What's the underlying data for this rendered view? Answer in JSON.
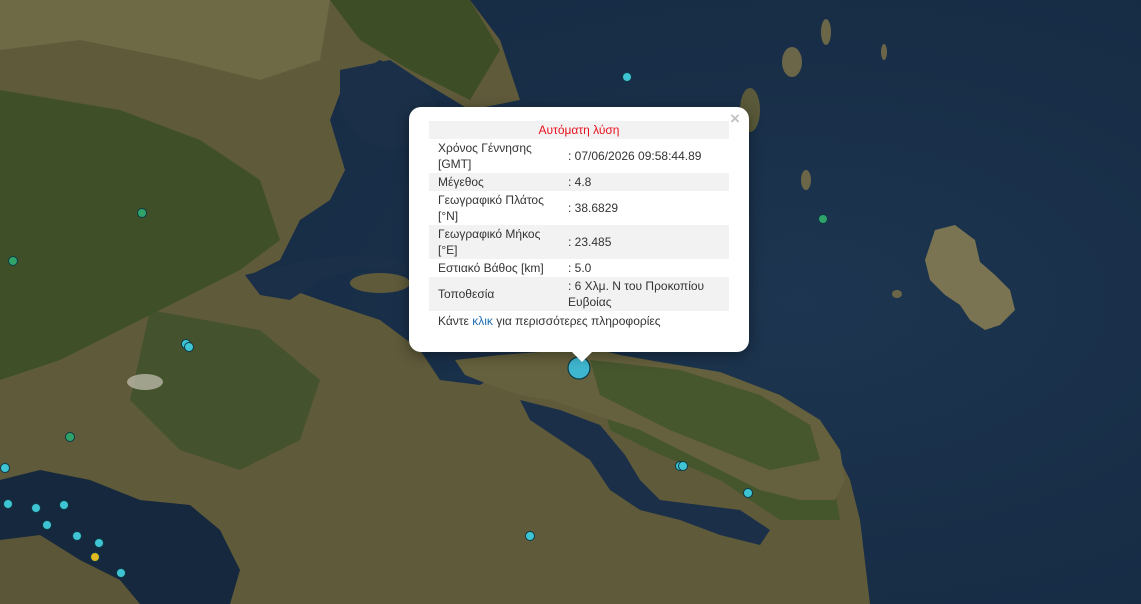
{
  "map": {
    "markers": [
      {
        "kind": "selected",
        "color": "#3fb6cf"
      },
      {
        "kind": "cyan",
        "color": "#3fc4d4"
      },
      {
        "kind": "green",
        "color": "#2fa36a"
      },
      {
        "kind": "yellow",
        "color": "#e0b822"
      }
    ],
    "colors": {
      "sea": "#1b2f47",
      "land": "#6f6a45",
      "forest": "#344a24",
      "deep": "#0f2033"
    }
  },
  "popup": {
    "header": "Αυτόματη λύση",
    "close_symbol": "×",
    "rows": [
      {
        "label": "Χρόνος Γέννησης [GMT]",
        "value": ": 07/06/2026 09:58:44.89"
      },
      {
        "label": "Μέγεθος",
        "value": ": 4.8"
      },
      {
        "label": "Γεωγραφικό Πλάτος [°N]",
        "value": ": 38.6829"
      },
      {
        "label": "Γεωγραφικό Μήκος [°E]",
        "value": ": 23.485"
      },
      {
        "label": "Εστιακό Βάθος [km]",
        "value": ": 5.0"
      },
      {
        "label": "Τοποθεσία",
        "value": ": 6 Χλμ. Ν του Προκοπίου Ευβοίας"
      }
    ],
    "more_prefix": "Κάντε ",
    "more_link": "κλικ",
    "more_suffix": " για περισσότερες πληροφορίες"
  }
}
